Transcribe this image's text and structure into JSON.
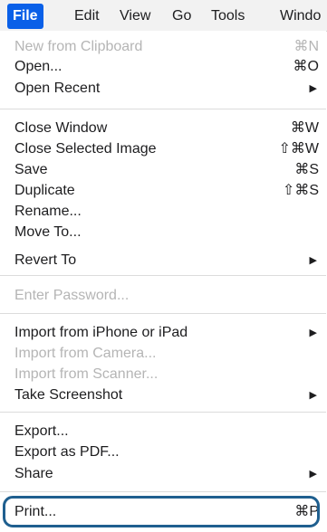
{
  "menubar": {
    "items": [
      {
        "label": "File",
        "active": true
      },
      {
        "label": "Edit"
      },
      {
        "label": "View"
      },
      {
        "label": "Go"
      },
      {
        "label": "Tools"
      },
      {
        "label": "Windo"
      }
    ]
  },
  "file_menu": {
    "items": [
      {
        "label": "New from Clipboard",
        "shortcut": "⌘N",
        "disabled": true
      },
      {
        "label": "Open...",
        "shortcut": "⌘O"
      },
      {
        "label": "Open Recent",
        "submenu": "▶"
      },
      {
        "label": "Close Window",
        "shortcut": "⌘W"
      },
      {
        "label": "Close Selected Image",
        "shortcut": "⇧⌘W"
      },
      {
        "label": "Save",
        "shortcut": "⌘S"
      },
      {
        "label": "Duplicate",
        "shortcut": "⇧⌘S"
      },
      {
        "label": "Rename..."
      },
      {
        "label": "Move To..."
      },
      {
        "label": "Revert To",
        "submenu": "▶"
      },
      {
        "label": "Enter Password...",
        "disabled": true
      },
      {
        "label": "Import from iPhone or iPad",
        "submenu": "▶"
      },
      {
        "label": "Import from Camera...",
        "disabled": true
      },
      {
        "label": "Import from Scanner...",
        "disabled": true
      },
      {
        "label": "Take Screenshot",
        "submenu": "▶"
      },
      {
        "label": "Export..."
      },
      {
        "label": "Export as PDF..."
      },
      {
        "label": "Share",
        "submenu": "▶"
      },
      {
        "label": "Print...",
        "shortcut": "⌘P",
        "highlighted": true
      }
    ]
  },
  "colors": {
    "menubar_active": "#0a60e8",
    "disabled_text": "#b5b5b5",
    "highlight_ring": "#1f5f8f"
  }
}
